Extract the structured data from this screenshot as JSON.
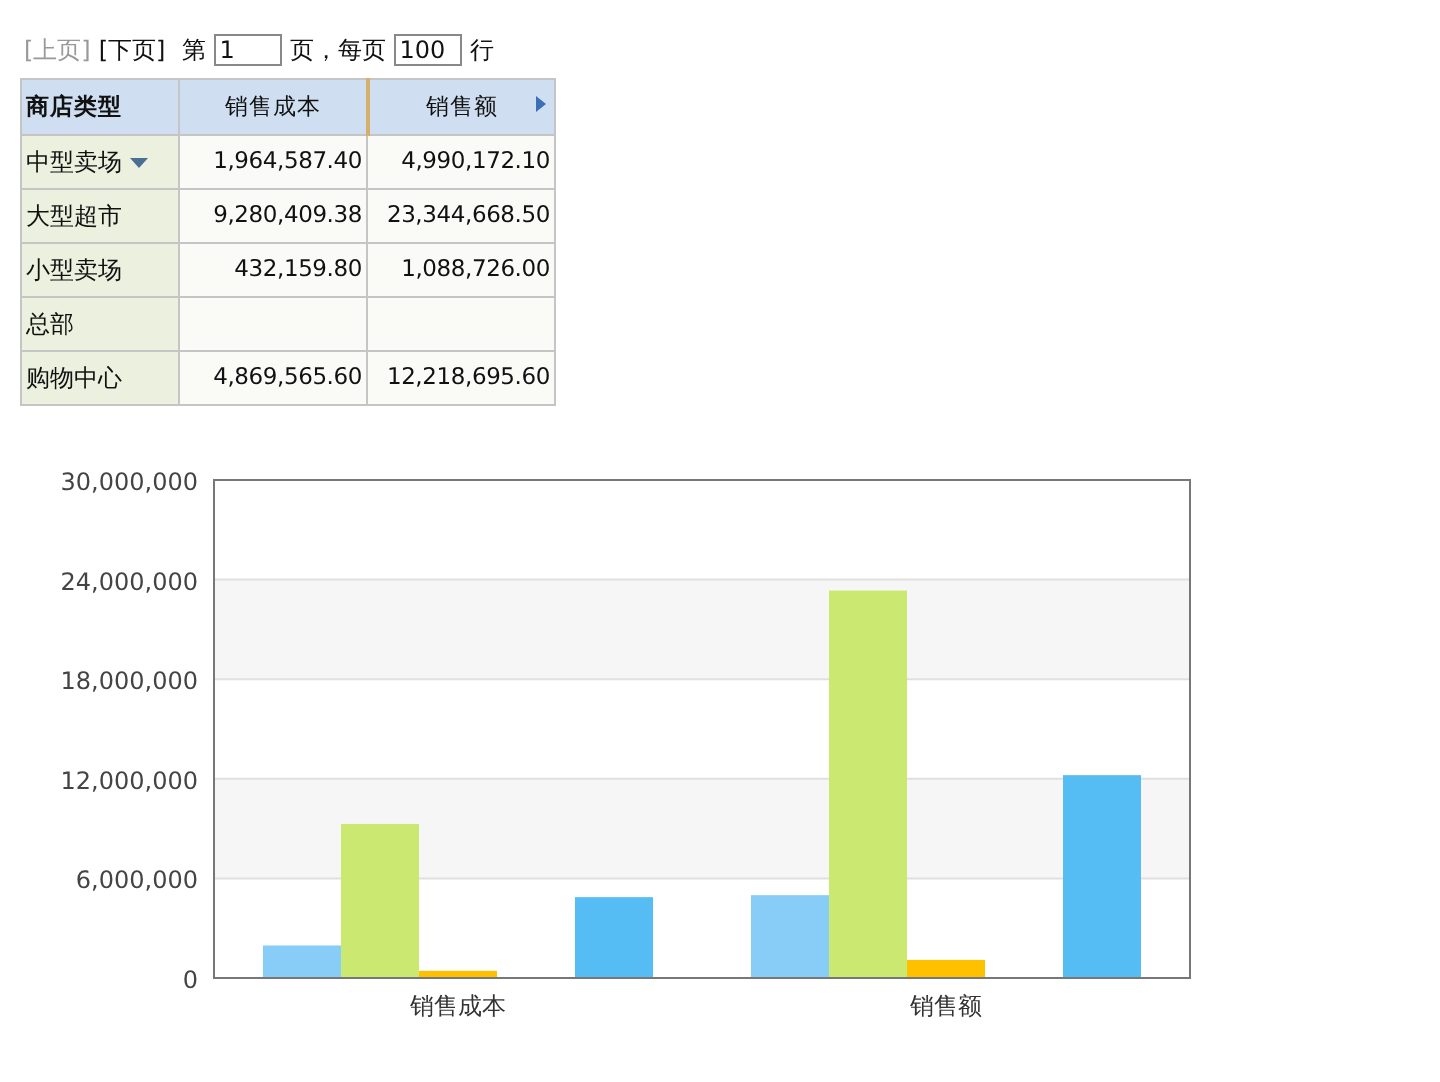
{
  "pager": {
    "prev": "[上页]",
    "prev_disabled": true,
    "next": "[下页]",
    "page_prefix": "第",
    "page": "1",
    "page_suffix": "页，每页",
    "page_size": "100",
    "size_suffix": "行"
  },
  "table": {
    "columns": [
      {
        "label": "商店类型",
        "kind": "text"
      },
      {
        "label": "销售成本",
        "kind": "number"
      },
      {
        "label": "销售额",
        "kind": "number"
      }
    ],
    "rows": [
      {
        "cells": [
          "中型卖场",
          "1,964,587.40",
          "4,990,172.10"
        ],
        "dropdown": true
      },
      {
        "cells": [
          "大型超市",
          "9,280,409.38",
          "23,344,668.50"
        ],
        "dropdown": false
      },
      {
        "cells": [
          "小型卖场",
          "432,159.80",
          "1,088,726.00"
        ],
        "dropdown": false
      },
      {
        "cells": [
          "总部",
          "",
          ""
        ],
        "dropdown": false
      },
      {
        "cells": [
          "购物中心",
          "4,869,565.60",
          "12,218,695.60"
        ],
        "dropdown": false
      }
    ]
  },
  "chart_data": {
    "type": "bar",
    "grid": true,
    "categories": [
      "销售成本",
      "销售额"
    ],
    "ylim": [
      0,
      30000000
    ],
    "yticks": [
      {
        "value": 0,
        "label": "0"
      },
      {
        "value": 6000000,
        "label": "6,000,000"
      },
      {
        "value": 12000000,
        "label": "12,000,000"
      },
      {
        "value": 18000000,
        "label": "18,000,000"
      },
      {
        "value": 24000000,
        "label": "24,000,000"
      },
      {
        "value": 30000000,
        "label": "30,000,000"
      }
    ],
    "series": [
      {
        "color": "#88cdf8",
        "values": [
          1960000,
          4990000
        ]
      },
      {
        "color": "#cbe970",
        "values": [
          9280000,
          23340000
        ]
      },
      {
        "color": "#ffc000",
        "values": [
          430000,
          1090000
        ]
      },
      {
        "values": [
          null,
          null
        ]
      },
      {
        "color": "#55bdf3",
        "values": [
          4870000,
          12220000
        ]
      }
    ]
  }
}
